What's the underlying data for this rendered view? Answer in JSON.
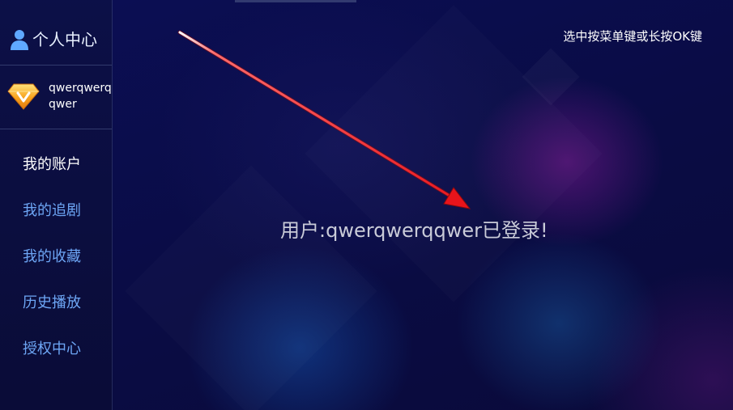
{
  "sidebar": {
    "title": "个人中心",
    "title_icon": "person-icon",
    "user": {
      "icon": "vip-diamond-icon",
      "name": "qwerqwerqqwer"
    },
    "menu": [
      {
        "label": "我的账户",
        "active": true
      },
      {
        "label": "我的追剧",
        "active": false
      },
      {
        "label": "我的收藏",
        "active": false
      },
      {
        "label": "历史播放",
        "active": false
      },
      {
        "label": "授权中心",
        "active": false
      }
    ]
  },
  "main": {
    "hint": "选中按菜单键或长按OK键",
    "status_message": "用户:qwerqwerqqwer已登录!"
  },
  "colors": {
    "background": "#0a0d4a",
    "menu_inactive": "#6da6f5",
    "menu_active": "#ffffff",
    "annotation_arrow": "#e8141b"
  }
}
